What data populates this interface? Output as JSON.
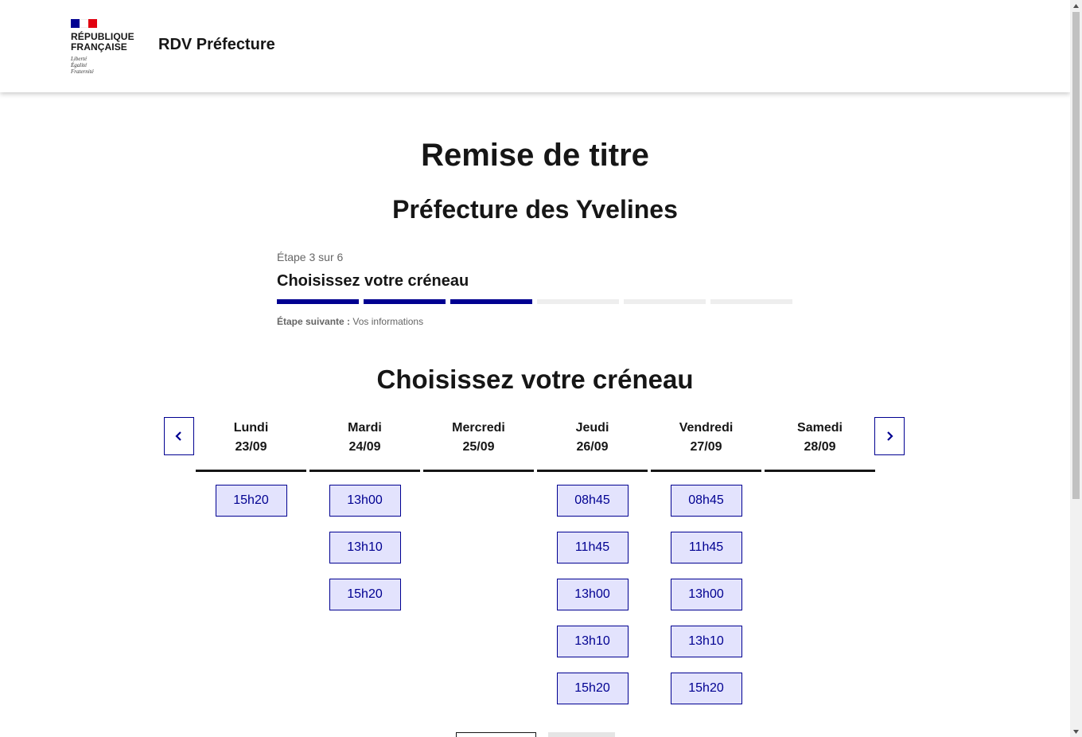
{
  "header": {
    "logo_line1": "RÉPUBLIQUE",
    "logo_line2": "FRANÇAISE",
    "devise": [
      "Liberté",
      "Égalité",
      "Fraternité"
    ],
    "service_title": "RDV Préfecture"
  },
  "page": {
    "title": "Remise de titre",
    "subtitle": "Préfecture des Yvelines"
  },
  "stepper": {
    "state": "Étape 3 sur 6",
    "title": "Choisissez votre créneau",
    "current_step": 3,
    "total_steps": 6,
    "next_label": "Étape suivante :",
    "next_value": "Vos informations"
  },
  "calendar": {
    "heading": "Choisissez votre créneau",
    "days": [
      {
        "name": "Lundi",
        "date": "23/09",
        "slots": [
          "15h20"
        ]
      },
      {
        "name": "Mardi",
        "date": "24/09",
        "slots": [
          "13h00",
          "13h10",
          "15h20"
        ]
      },
      {
        "name": "Mercredi",
        "date": "25/09",
        "slots": []
      },
      {
        "name": "Jeudi",
        "date": "26/09",
        "slots": [
          "08h45",
          "11h45",
          "13h00",
          "13h10",
          "15h20"
        ]
      },
      {
        "name": "Vendredi",
        "date": "27/09",
        "slots": [
          "08h45",
          "11h45",
          "13h00",
          "13h10",
          "15h20"
        ]
      },
      {
        "name": "Samedi",
        "date": "28/09",
        "slots": []
      }
    ],
    "prev_icon": "chevron-left-icon",
    "next_icon": "chevron-right-icon"
  },
  "colors": {
    "primary": "#000091",
    "slot_bg": "#e3e3fd",
    "flag_red": "#e1000f"
  }
}
